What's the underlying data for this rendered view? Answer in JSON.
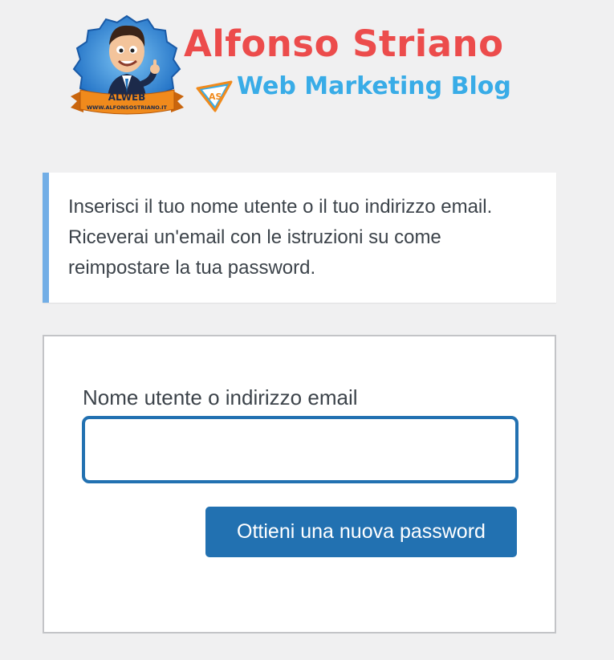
{
  "logo": {
    "brand_name": "Alfonso Striano",
    "tagline": "Web Marketing Blog",
    "badge_title": "ALWEB",
    "badge_url": "WWW.ALFONSOSTRIANO.IT",
    "icon_letters": "AS",
    "badge_icon": "mascot-badge",
    "colors": {
      "brand_red": "#ec4c4c",
      "tagline_blue": "#39ace7",
      "badge_blue": "#2d7fd0",
      "ribbon_orange": "#f08a1c"
    }
  },
  "message": {
    "text": "Inserisci il tuo nome utente o il tuo indirizzo email. Riceverai un'email con le istruzioni su come reimpostare la tua password.",
    "accent_color": "#72aee6"
  },
  "form": {
    "field_label": "Nome utente o indirizzo email",
    "field_value": "",
    "submit_label": "Ottieni una nuova password",
    "primary_color": "#2271b1"
  }
}
